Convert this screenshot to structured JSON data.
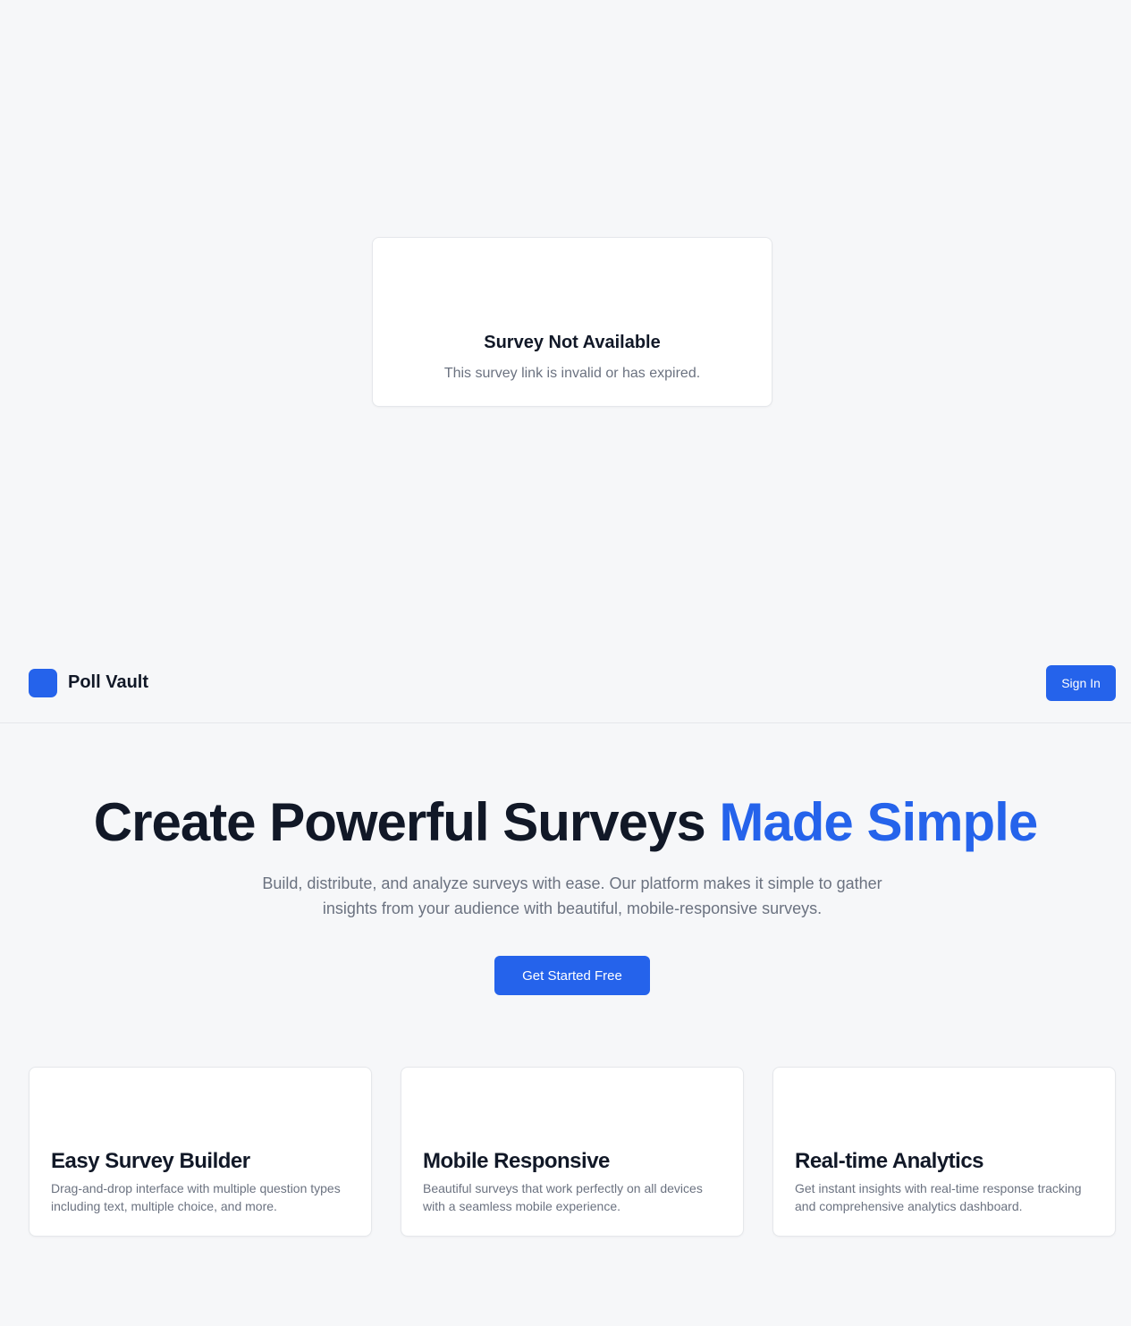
{
  "error_card": {
    "icon": "alert-icon",
    "title": "Survey Not Available",
    "message": "This survey link is invalid or has expired."
  },
  "header": {
    "logo_icon": "logo-icon",
    "brand": "Poll Vault",
    "sign_in_label": "Sign In"
  },
  "hero": {
    "title_main": "Create Powerful Surveys",
    "title_accent": "Made Simple",
    "subtitle": "Build, distribute, and analyze surveys with ease. Our platform makes it simple to gather insights from your audience with beautiful, mobile-responsive surveys.",
    "cta_label": "Get Started Free"
  },
  "features": [
    {
      "icon": "builder-icon",
      "title": "Easy Survey Builder",
      "description": "Drag-and-drop interface with multiple question types including text, multiple choice, and more."
    },
    {
      "icon": "mobile-icon",
      "title": "Mobile Responsive",
      "description": "Beautiful surveys that work perfectly on all devices with a seamless mobile experience."
    },
    {
      "icon": "analytics-icon",
      "title": "Real-time Analytics",
      "description": "Get instant insights with real-time response tracking and comprehensive analytics dashboard."
    }
  ],
  "colors": {
    "accent": "#2563eb",
    "background": "#f6f7f9",
    "card": "#ffffff",
    "text": "#111827",
    "muted": "#6b7280"
  }
}
